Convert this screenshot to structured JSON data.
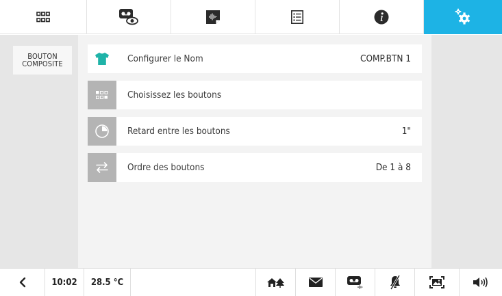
{
  "top_tabs": [
    {
      "name": "tab-apps",
      "icon": "grid-icon"
    },
    {
      "name": "tab-video-messages",
      "icon": "voicemail-eye-icon"
    },
    {
      "name": "tab-intercom",
      "icon": "audio-doc-icon"
    },
    {
      "name": "tab-list",
      "icon": "list-icon"
    },
    {
      "name": "tab-info",
      "icon": "info-icon"
    },
    {
      "name": "tab-settings",
      "icon": "gears-icon",
      "active": true
    }
  ],
  "colors": {
    "accent": "#1db3e5",
    "teal_icon": "#1fb3a8",
    "row_icon_bg": "#b4b4b4"
  },
  "sidebar": {
    "items": [
      {
        "label": "BOUTON\nCOMPOSITE"
      }
    ]
  },
  "main": {
    "rows": [
      {
        "icon": "tshirt-icon",
        "label": "Configurer le Nom",
        "value": "COMP.BTN 1"
      },
      {
        "icon": "buttons-grid-icon",
        "label": "Choisissez les boutons",
        "value": ""
      },
      {
        "icon": "timer-icon",
        "label": "Retard entre les boutons",
        "value": "1\""
      },
      {
        "icon": "swap-arrows-icon",
        "label": "Ordre des boutons",
        "value": "De 1 à 8"
      }
    ]
  },
  "bottombar": {
    "time": "10:02",
    "temperature": "28.5 °C",
    "icons": [
      "back-arrow-icon",
      "home-alarm-icon",
      "mail-icon",
      "voicemail-icon",
      "ringer-off-icon",
      "picture-frame-icon",
      "speaker-icon"
    ]
  }
}
